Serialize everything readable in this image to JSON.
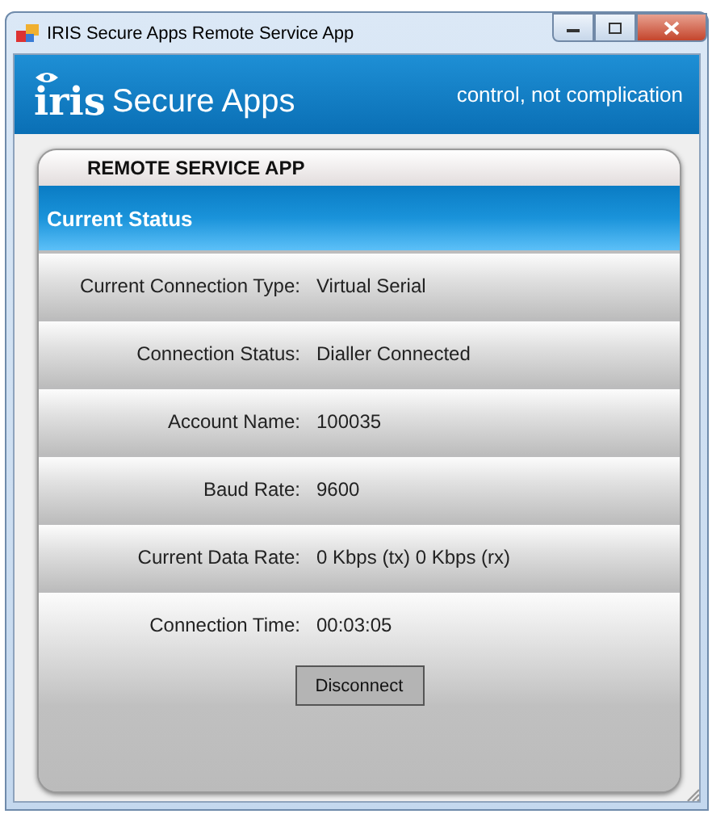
{
  "window": {
    "title": "IRIS Secure Apps Remote Service App"
  },
  "banner": {
    "logo": "iris",
    "brand": "Secure Apps",
    "tagline": "control, not complication"
  },
  "panel": {
    "title": "REMOTE SERVICE APP",
    "section": "Current Status",
    "rows": [
      {
        "label": "Current Connection Type:",
        "value": "Virtual Serial"
      },
      {
        "label": "Connection Status:",
        "value": "Dialler Connected"
      },
      {
        "label": "Account Name:",
        "value": "100035"
      },
      {
        "label": "Baud Rate:",
        "value": "9600"
      },
      {
        "label": "Current Data Rate:",
        "value": "0 Kbps (tx) 0 Kbps (rx)"
      },
      {
        "label": "Connection Time:",
        "value": "00:03:05"
      }
    ],
    "button": "Disconnect"
  }
}
